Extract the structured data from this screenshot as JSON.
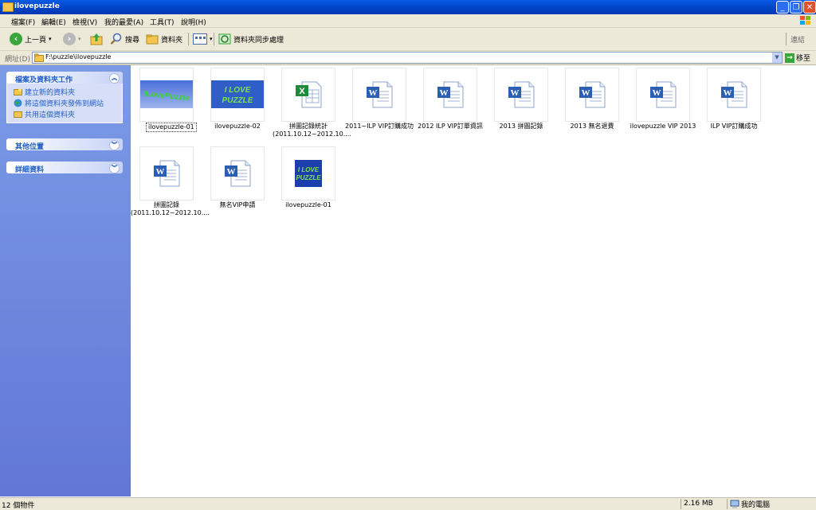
{
  "window": {
    "title": "ilovepuzzle"
  },
  "menu": [
    "檔案(F)",
    "編輯(E)",
    "檢視(V)",
    "我的最愛(A)",
    "工具(T)",
    "說明(H)"
  ],
  "toolbar": {
    "back": "上一頁",
    "search": "搜尋",
    "folders": "資料夾",
    "sync": "資料夾同步處理",
    "links": "連結"
  },
  "address": {
    "label": "網址(D)",
    "value": "F:\\puzzle\\ilovepuzzle",
    "go": "移至"
  },
  "sidebar": {
    "tasks_title": "檔案及資料夾工作",
    "tasks": [
      "建立新的資料夾",
      "將這個資料夾發佈到網站",
      "共用這個資料夾"
    ],
    "other_title": "其他位置",
    "details_title": "詳細資料"
  },
  "files": [
    {
      "name": "ilovepuzzle-01",
      "type": "image-green",
      "selected": true
    },
    {
      "name": "ilovepuzzle-02",
      "type": "image-blue"
    },
    {
      "name": "拼圖記錄統計\n(2011.10.12~2012.10....",
      "type": "excel"
    },
    {
      "name": "2011~ILP VIP訂購成功",
      "type": "word"
    },
    {
      "name": "2012 ILP VIP訂單資訊",
      "type": "word"
    },
    {
      "name": "2013 拼圖記錄",
      "type": "word"
    },
    {
      "name": "2013 無名退費",
      "type": "word"
    },
    {
      "name": "ilovepuzzle VIP 2013",
      "type": "word"
    },
    {
      "name": "ILP VIP訂購成功",
      "type": "word"
    },
    {
      "name": "拼圖記錄\n(2011.10.12~2012.10....",
      "type": "word"
    },
    {
      "name": "無名VIP申請",
      "type": "word"
    },
    {
      "name": "ilovepuzzle-01",
      "type": "image-square"
    }
  ],
  "thumb_text": {
    "line1": "I LOVE",
    "line2": "PUZZLE",
    "wave": "ILovePuzzle"
  },
  "status": {
    "count": "12 個物件",
    "size": "2.16 MB",
    "location": "我的電腦"
  },
  "colors": {
    "title_bar": "#0047c9",
    "sidebar": "#6b85dc",
    "link_blue": "#215dc6"
  }
}
